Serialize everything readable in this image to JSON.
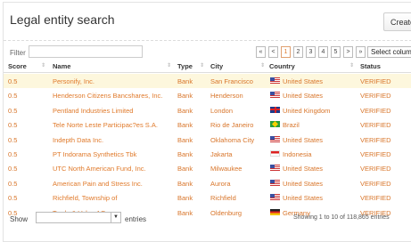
{
  "header": {
    "title": "Legal entity search",
    "create_label": "Create"
  },
  "filter": {
    "label": "Filter",
    "value": ""
  },
  "pagination": {
    "prev_prev": "«",
    "prev": "<",
    "pages": [
      "1",
      "2",
      "3",
      "4",
      "5"
    ],
    "active_page": "1",
    "next": ">",
    "next_next": "»"
  },
  "select_columns_label": "Select columns",
  "table": {
    "columns": [
      "Score",
      "Name",
      "Type",
      "City",
      "Country",
      "Status"
    ],
    "rows": [
      {
        "score": "0.5",
        "name": "Personify, Inc.",
        "type": "Bank",
        "city": "San Francisco",
        "country": "United States",
        "flag": "us",
        "status": "VERIFIED",
        "highlight": true
      },
      {
        "score": "0.5",
        "name": "Henderson Citizens Bancshares, Inc.",
        "type": "Bank",
        "city": "Henderson",
        "country": "United States",
        "flag": "us",
        "status": "VERIFIED"
      },
      {
        "score": "0.5",
        "name": "Pentland Industries Limited",
        "type": "Bank",
        "city": "London",
        "country": "United Kingdom",
        "flag": "uk",
        "status": "VERIFIED"
      },
      {
        "score": "0.5",
        "name": "Tele Norte Leste Participac?es S.A.",
        "type": "Bank",
        "city": "Rio de Janeiro",
        "country": "Brazil",
        "flag": "br",
        "status": "VERIFIED"
      },
      {
        "score": "0.5",
        "name": "Indepth Data Inc.",
        "type": "Bank",
        "city": "Oklahoma City",
        "country": "United States",
        "flag": "us",
        "status": "VERIFIED"
      },
      {
        "score": "0.5",
        "name": "PT Indorama Synthetics Tbk",
        "type": "Bank",
        "city": "Jakarta",
        "country": "Indonesia",
        "flag": "id",
        "status": "VERIFIED"
      },
      {
        "score": "0.5",
        "name": "UTC North American Fund, Inc.",
        "type": "Bank",
        "city": "Milwaukee",
        "country": "United States",
        "flag": "us",
        "status": "VERIFIED"
      },
      {
        "score": "0.5",
        "name": "American Pain and Stress Inc.",
        "type": "Bank",
        "city": "Aurora",
        "country": "United States",
        "flag": "us",
        "status": "VERIFIED"
      },
      {
        "score": "0.5",
        "name": "Richfield, Township of",
        "type": "Bank",
        "city": "Richfield",
        "country": "United States",
        "flag": "us",
        "status": "VERIFIED"
      },
      {
        "score": "0.5",
        "name": "Trade & Value AG",
        "type": "Bank",
        "city": "Oldenburg",
        "country": "Germany",
        "flag": "de",
        "status": "VERIFIED"
      }
    ]
  },
  "footer": {
    "show_label": "Show",
    "show_value": "",
    "entries_label": "entries",
    "showing_text": "Showing 1 to 10 of 118,865 entries"
  },
  "colors": {
    "link": "#e07a2b",
    "highlight_row": "#fdf7dd"
  }
}
